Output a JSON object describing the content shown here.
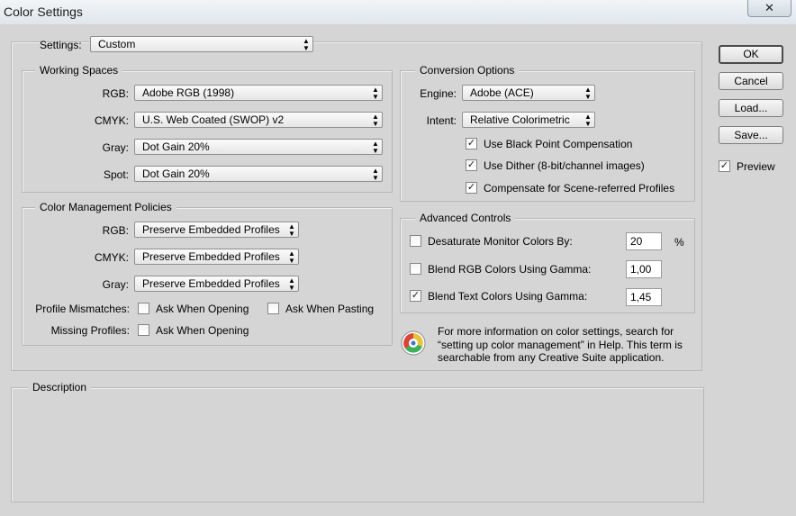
{
  "window": {
    "title": "Color Settings",
    "close_glyph": "✕"
  },
  "settings": {
    "label": "Settings:",
    "value": "Custom"
  },
  "working_spaces": {
    "title": "Working Spaces",
    "rgb": {
      "label": "RGB:",
      "value": "Adobe RGB (1998)"
    },
    "cmyk": {
      "label": "CMYK:",
      "value": "U.S. Web Coated (SWOP) v2"
    },
    "gray": {
      "label": "Gray:",
      "value": "Dot Gain 20%"
    },
    "spot": {
      "label": "Spot:",
      "value": "Dot Gain 20%"
    }
  },
  "policies": {
    "title": "Color Management Policies",
    "rgb": {
      "label": "RGB:",
      "value": "Preserve Embedded Profiles"
    },
    "cmyk": {
      "label": "CMYK:",
      "value": "Preserve Embedded Profiles"
    },
    "gray": {
      "label": "Gray:",
      "value": "Preserve Embedded Profiles"
    },
    "mismatches": {
      "label": "Profile Mismatches:",
      "opening": "Ask When Opening",
      "pasting": "Ask When Pasting",
      "opening_checked": false,
      "pasting_checked": false
    },
    "missing": {
      "label": "Missing Profiles:",
      "opening": "Ask When Opening",
      "opening_checked": false
    }
  },
  "conversion": {
    "title": "Conversion Options",
    "engine": {
      "label": "Engine:",
      "value": "Adobe (ACE)"
    },
    "intent": {
      "label": "Intent:",
      "value": "Relative Colorimetric"
    },
    "black_point": {
      "label": "Use Black Point Compensation",
      "checked": true
    },
    "dither": {
      "label": "Use Dither (8-bit/channel images)",
      "checked": true
    },
    "scene": {
      "label": "Compensate for Scene-referred Profiles",
      "checked": true
    }
  },
  "advanced": {
    "title": "Advanced Controls",
    "desaturate": {
      "label": "Desaturate Monitor Colors By:",
      "value": "20",
      "unit": "%",
      "checked": false
    },
    "blend_rgb": {
      "label": "Blend RGB Colors Using Gamma:",
      "value": "1,00",
      "checked": false
    },
    "blend_text": {
      "label": "Blend Text Colors Using Gamma:",
      "value": "1,45",
      "checked": true
    }
  },
  "info": {
    "line1": "For more information on color settings, search for",
    "line2": "“setting up color management” in Help. This term is",
    "line3": "searchable from any Creative Suite application.",
    "icon": "color-wheel-icon"
  },
  "description": {
    "title": "Description"
  },
  "buttons": {
    "ok": "OK",
    "cancel": "Cancel",
    "load": "Load...",
    "save": "Save...",
    "preview": "Preview",
    "preview_checked": true
  },
  "glyphs": {
    "check": "✓",
    "arrows": "▲\n▼"
  }
}
